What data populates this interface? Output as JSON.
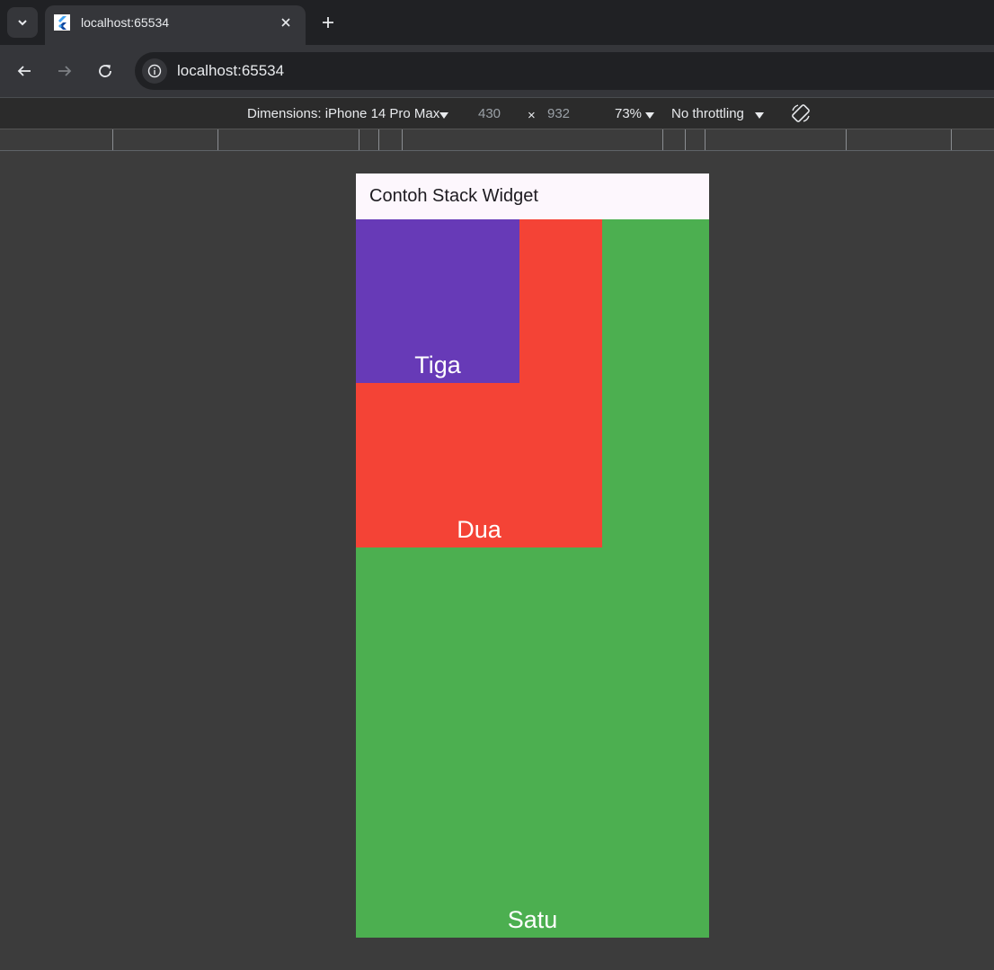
{
  "browser": {
    "tab": {
      "title": "localhost:65534",
      "close_icon": "close-icon"
    },
    "new_tab_icon": "plus-icon",
    "url": "localhost:65534"
  },
  "device_toolbar": {
    "dimensions_label": "Dimensions: iPhone 14 Pro Max",
    "width_value": "430",
    "times": "×",
    "height_value": "932",
    "zoom": "73%",
    "throttling": "No throttling"
  },
  "app": {
    "title": "Contoh Stack Widget",
    "boxes": {
      "satu": {
        "label": "Satu",
        "color": "#4caf50"
      },
      "dua": {
        "label": "Dua",
        "color": "#f44336"
      },
      "tiga": {
        "label": "Tiga",
        "color": "#673ab7"
      }
    }
  }
}
